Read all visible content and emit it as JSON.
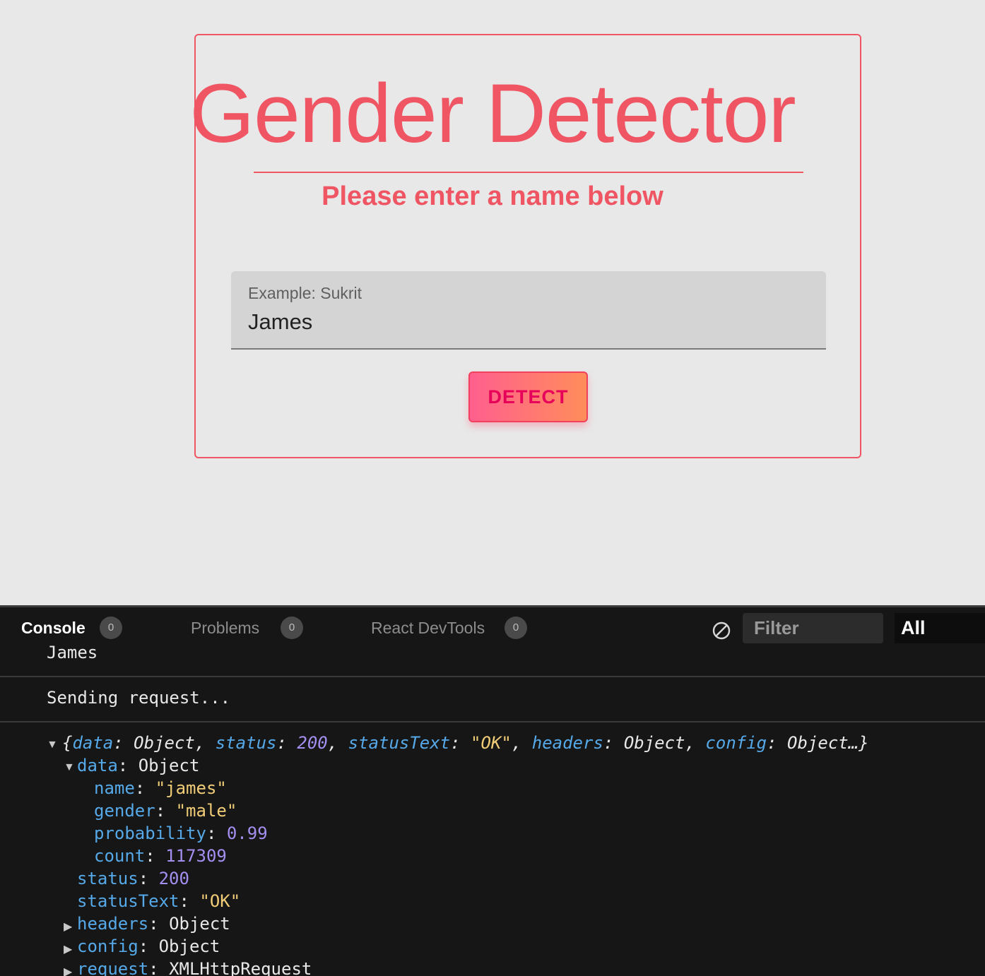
{
  "app": {
    "title": "Gender Detector",
    "subtitle": "Please enter a name below",
    "name_field": {
      "label": "Example: Sukrit",
      "value": "James"
    },
    "detect_button": "DETECT"
  },
  "devtools": {
    "tabs": [
      {
        "label": "Console",
        "count": "0"
      },
      {
        "label": "Problems",
        "count": "0"
      },
      {
        "label": "React DevTools",
        "count": "0"
      }
    ],
    "filter_placeholder": "Filter",
    "level": "All",
    "logs": [
      "James",
      "Sending request..."
    ],
    "summary": {
      "open": "{",
      "data_key": "data",
      "data_val": "Object",
      "status_key": "status",
      "status_val": "200",
      "statusText_key": "statusText",
      "statusText_val": "\"OK\"",
      "headers_key": "headers",
      "headers_val": "Object",
      "config_key": "config",
      "config_val": "Object…}"
    },
    "tree": {
      "data_key": "data",
      "data_val": "Object",
      "name_key": "name",
      "name_val": "\"james\"",
      "gender_key": "gender",
      "gender_val": "\"male\"",
      "probability_key": "probability",
      "probability_val": "0.99",
      "count_key": "count",
      "count_val": "117309",
      "status_key": "status",
      "status_val": "200",
      "statusText_key": "statusText",
      "statusText_val": "\"OK\"",
      "headers_key": "headers",
      "headers_val": "Object",
      "config_key": "config",
      "config_val": "Object",
      "request_key": "request",
      "request_val": "XMLHttpRequest"
    },
    "colors": {
      "key": "#56a9e8",
      "string": "#f2cd78",
      "number": "#a48ff0",
      "accent": "#ef5563"
    }
  }
}
